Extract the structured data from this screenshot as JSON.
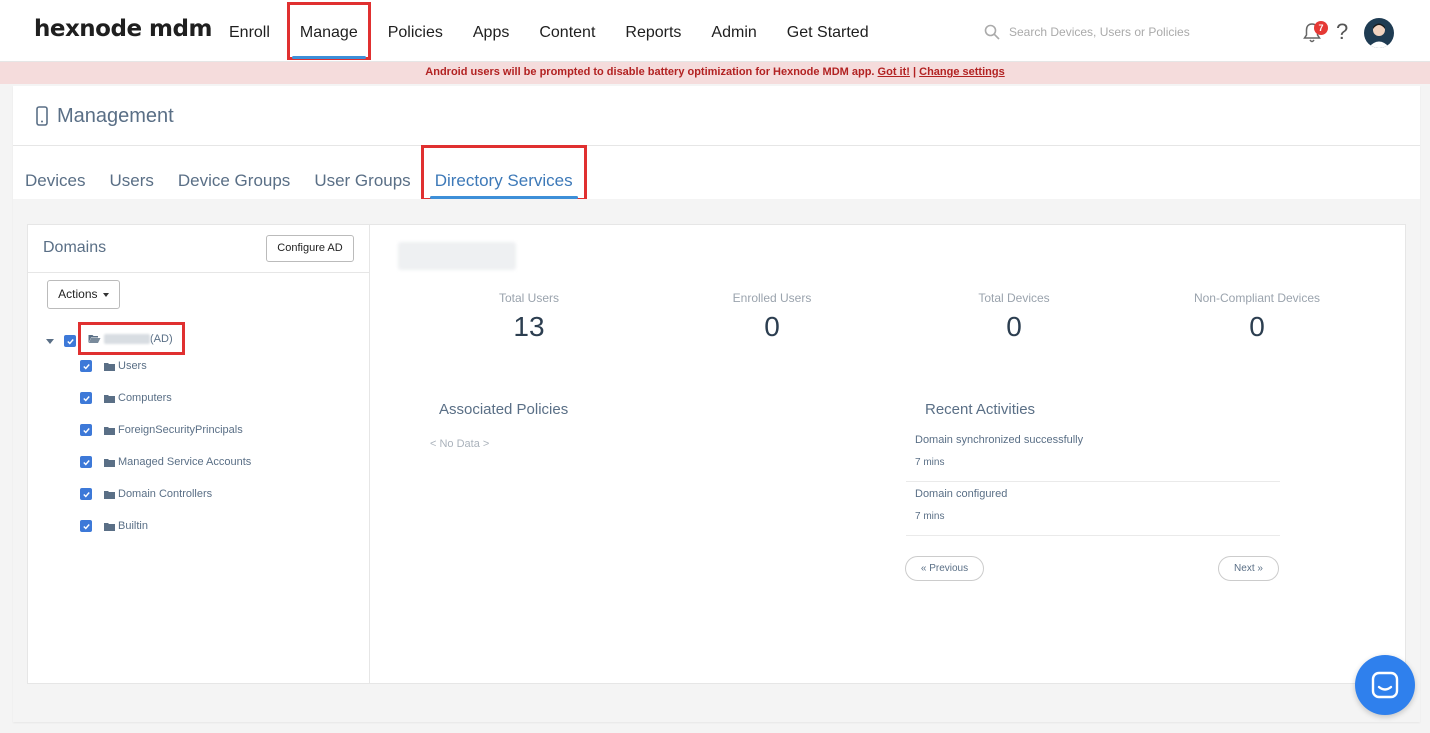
{
  "app": {
    "logo": "hexnode mdm"
  },
  "nav": {
    "items": [
      {
        "label": "Enroll"
      },
      {
        "label": "Manage"
      },
      {
        "label": "Policies"
      },
      {
        "label": "Apps"
      },
      {
        "label": "Content"
      },
      {
        "label": "Reports"
      },
      {
        "label": "Admin"
      },
      {
        "label": "Get Started"
      }
    ],
    "active": "Manage"
  },
  "search": {
    "placeholder": "Search Devices, Users or Policies"
  },
  "notifications": {
    "count": "7"
  },
  "help": {
    "label": "?"
  },
  "banner": {
    "message": "Android users will be prompted to disable battery optimization for Hexnode MDM app.",
    "got_it": "Got it!",
    "separator": "|",
    "change_settings": "Change settings"
  },
  "management": {
    "title": "Management"
  },
  "tabs": [
    {
      "label": "Devices"
    },
    {
      "label": "Users"
    },
    {
      "label": "Device Groups"
    },
    {
      "label": "User Groups"
    },
    {
      "label": "Directory Services"
    }
  ],
  "domains": {
    "title": "Domains",
    "configure_label": "Configure AD",
    "actions_label": "Actions",
    "root_suffix": "(AD)",
    "children": [
      {
        "label": "Users"
      },
      {
        "label": "Computers"
      },
      {
        "label": "ForeignSecurityPrincipals"
      },
      {
        "label": "Managed Service Accounts"
      },
      {
        "label": "Domain Controllers"
      },
      {
        "label": "Builtin"
      }
    ]
  },
  "stats": [
    {
      "label": "Total Users",
      "value": "13"
    },
    {
      "label": "Enrolled Users",
      "value": "0"
    },
    {
      "label": "Total Devices",
      "value": "0"
    },
    {
      "label": "Non-Compliant Devices",
      "value": "0"
    }
  ],
  "associated_policies": {
    "title": "Associated Policies",
    "empty": "< No Data >"
  },
  "recent_activities": {
    "title": "Recent Activities",
    "items": [
      {
        "text": "Domain synchronized successfully",
        "time": "7 mins"
      },
      {
        "text": "Domain configured",
        "time": "7 mins"
      }
    ],
    "previous": "« Previous",
    "next": "Next »"
  },
  "colors": {
    "accent": "#3d8fd8",
    "highlight": "#e03030",
    "banner_bg": "#f5dcdc",
    "banner_text": "#b22222",
    "chat": "#2f80ed"
  }
}
